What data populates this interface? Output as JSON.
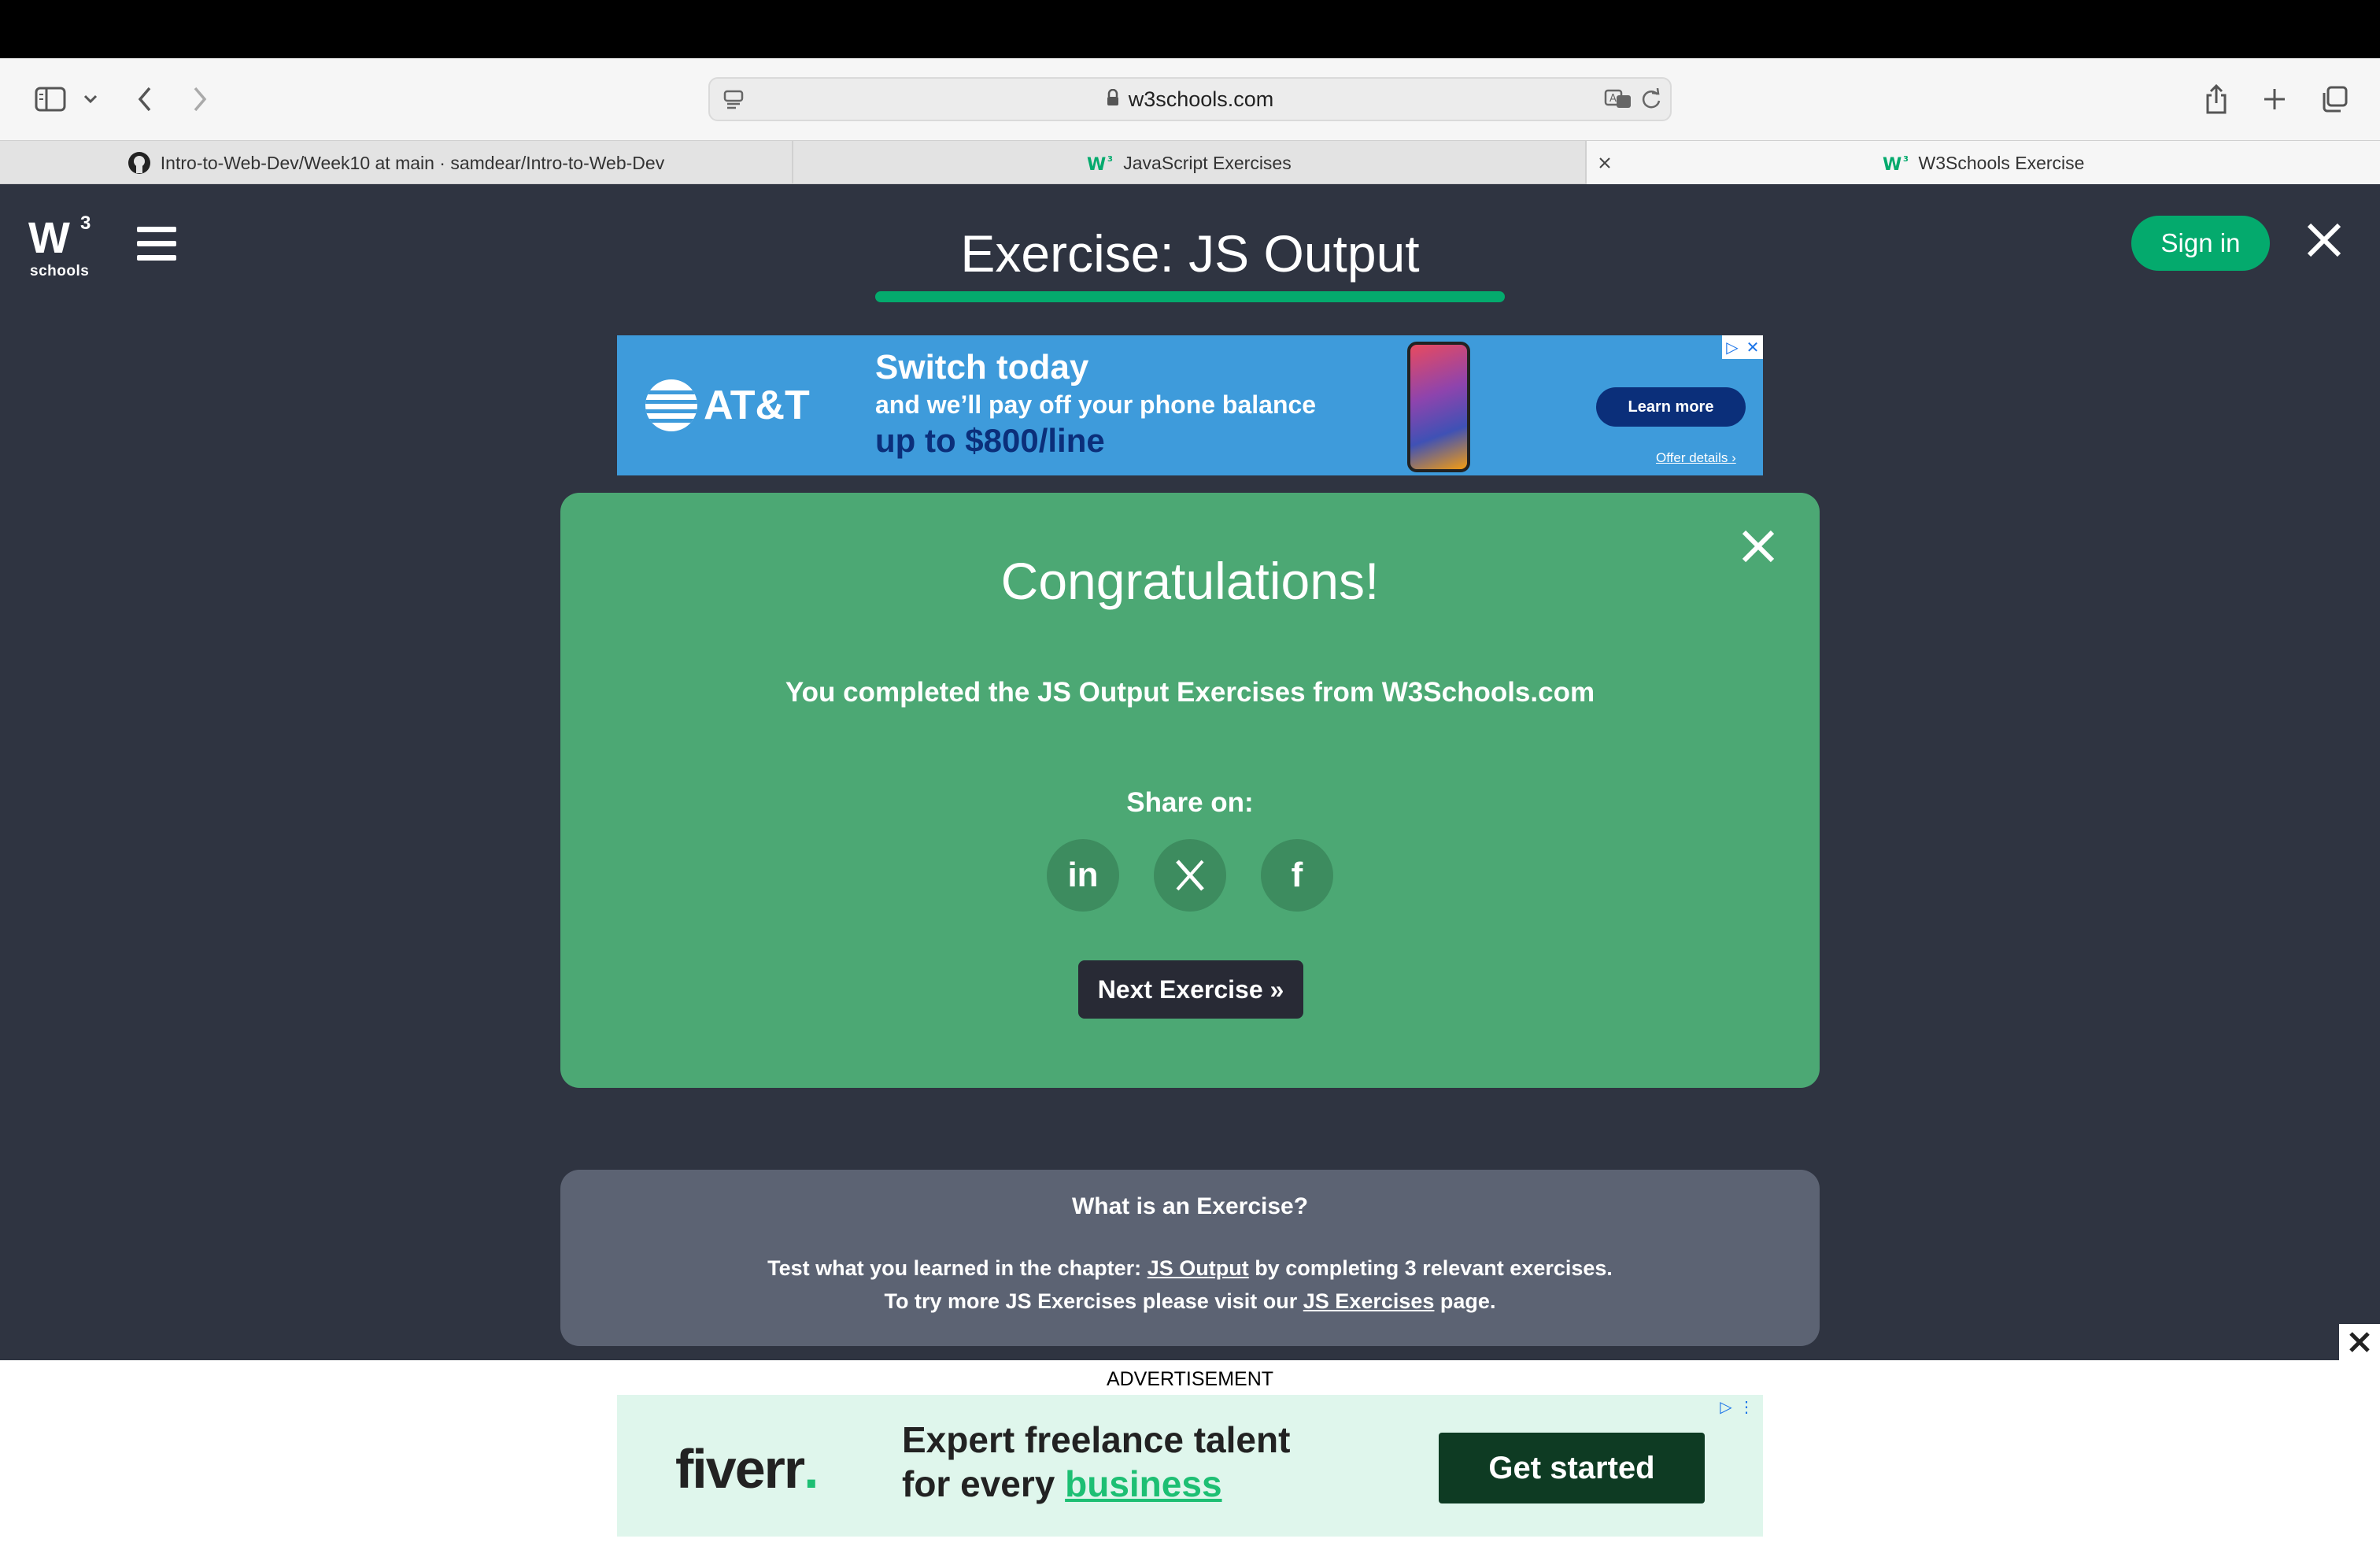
{
  "browser": {
    "address": "w3schools.com",
    "tabs": [
      {
        "title": "Intro-to-Web-Dev/Week10 at main · samdear/Intro-to-Web-Dev",
        "icon": "github-icon"
      },
      {
        "title": "JavaScript Exercises",
        "icon": "w3schools-icon"
      },
      {
        "title": "W3Schools Exercise",
        "icon": "w3schools-icon",
        "active": true
      }
    ]
  },
  "header": {
    "logo_w": "W",
    "logo_sup": "3",
    "logo_sub": "schools",
    "title": "Exercise: JS Output",
    "signin": "Sign in",
    "accent": "#04AA6D"
  },
  "ad_top": {
    "brand": "AT&T",
    "headline": "Switch today",
    "line2": "and we’ll pay off your phone balance",
    "line3": "up to $800/line",
    "cta": "Learn more",
    "offer": "Offer details ›"
  },
  "congrats": {
    "title": "Congratulations!",
    "message": "You completed the JS Output Exercises from W3Schools.com",
    "share_label": "Share on:",
    "share": [
      "linkedin-icon",
      "x-icon",
      "facebook-icon"
    ],
    "linkedin": "in",
    "facebook": "f",
    "next": "Next Exercise »",
    "bg": "#4CA874"
  },
  "what": {
    "title": "What is an Exercise?",
    "l1_a": "Test what you learned in the chapter: ",
    "l1_link": "JS Output",
    "l1_b": " by completing 3 relevant exercises.",
    "l2_a": "To try more JS Exercises please visit our ",
    "l2_link": "JS Exercises",
    "l2_b": " page."
  },
  "ad_bottom": {
    "label": "ADVERTISEMENT",
    "brand": "fiverr",
    "brand_dot": ".",
    "line1": "Expert freelance talent",
    "line2_a": "for every ",
    "line2_b": "business",
    "cta": "Get started"
  }
}
